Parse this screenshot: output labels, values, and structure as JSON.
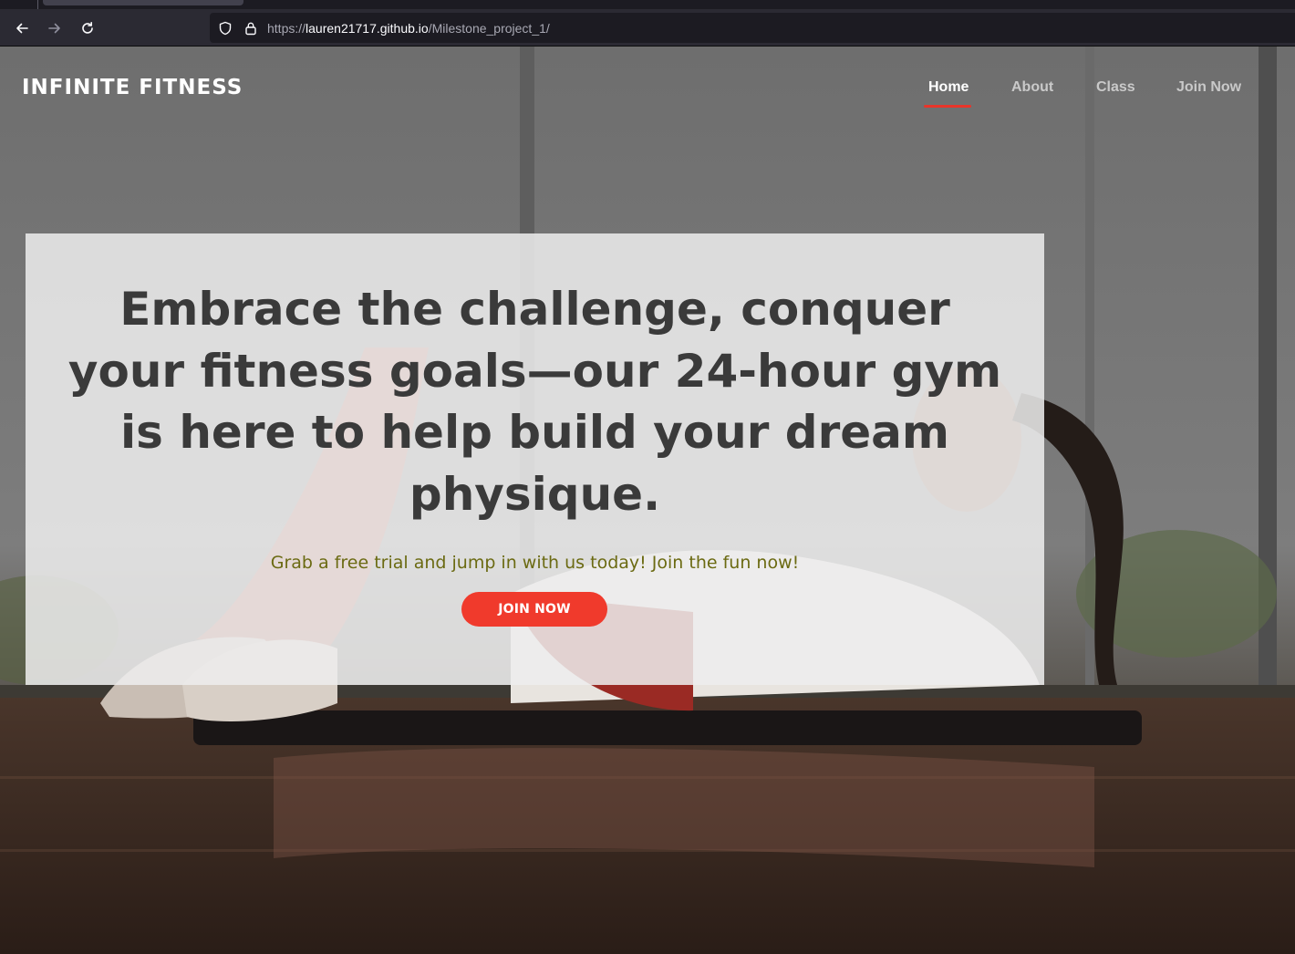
{
  "browser": {
    "url_prefix": "https://",
    "url_host": "lauren21717.github.io",
    "url_path": "/Milestone_project_1/",
    "icons": [
      "back-arrow-icon",
      "forward-arrow-icon",
      "reload-icon",
      "shield-icon",
      "lock-icon"
    ]
  },
  "site": {
    "brand": "INFINITE FITNESS",
    "nav": {
      "home": "Home",
      "about": "About",
      "class": "Class",
      "join": "Join Now",
      "active": "home"
    },
    "hero": {
      "headline": "Embrace the challenge, conquer your fitness goals—our 24-hour gym is here to help build your dream physique.",
      "subtitle": "Grab a free trial and jump in with us today! Join the fun now!",
      "cta_label": "JOIN NOW"
    }
  },
  "colors": {
    "accent": "#f03a2c",
    "subtitle": "#6b6a12",
    "headline": "#3a3a3a",
    "card": "#eeeeee",
    "browser_chrome": "#2b2a33",
    "url_bar": "#1c1b22"
  }
}
